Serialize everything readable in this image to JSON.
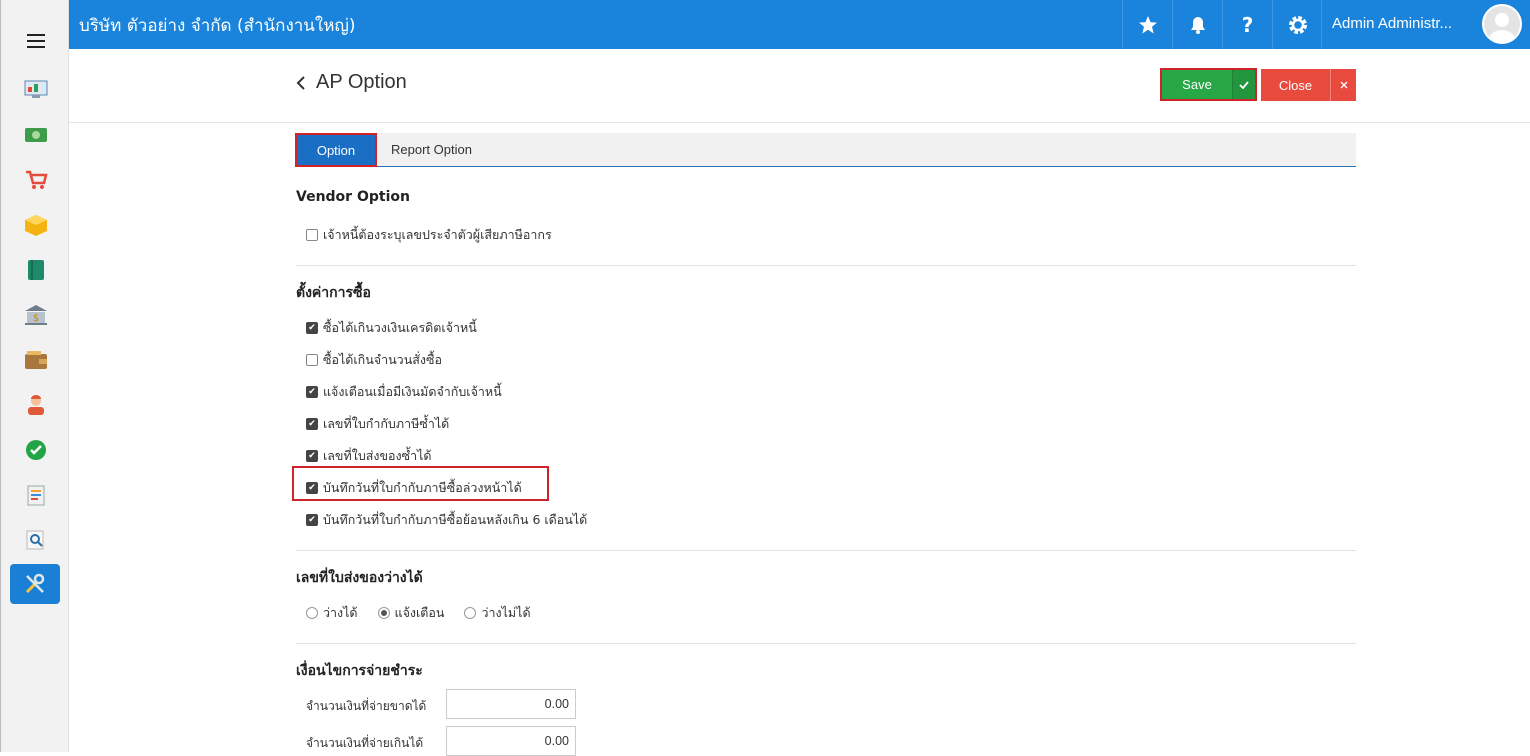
{
  "header": {
    "company": "บริษัท ตัวอย่าง จำกัด (สำนักงานใหญ่)",
    "user_name": "Admin Administr...",
    "help_label": "?"
  },
  "page": {
    "back_icon": "chevron-left-icon",
    "title": "AP Option",
    "save_label": "Save",
    "close_label": "Close"
  },
  "tabs": [
    {
      "label": "Option",
      "active": true
    },
    {
      "label": "Report Option",
      "active": false
    }
  ],
  "vendor_option": {
    "title": "Vendor Option",
    "items": [
      {
        "label": "เจ้าหนี้ต้องระบุเลขประจำตัวผู้เสียภาษีอากร",
        "checked": false
      }
    ]
  },
  "purchase_settings": {
    "title": "ตั้งค่าการซื้อ",
    "items": [
      {
        "label": "ซื้อได้เกินวงเงินเครดิตเจ้าหนี้",
        "checked": true
      },
      {
        "label": "ซื้อได้เกินจำนวนสั่งซื้อ",
        "checked": false
      },
      {
        "label": "แจ้งเตือนเมื่อมีเงินมัดจำกับเจ้าหนี้",
        "checked": true
      },
      {
        "label": "เลขที่ใบกำกับภาษีซ้ำได้",
        "checked": true
      },
      {
        "label": "เลขที่ใบส่งของซ้ำได้",
        "checked": true
      },
      {
        "label": "บันทึกวันที่ใบกำกับภาษีซื้อล่วงหน้าได้",
        "checked": true
      },
      {
        "label": "บันทึกวันที่ใบกำกับภาษีซื้อย้อนหลังเกิน 6 เดือนได้",
        "checked": true
      }
    ]
  },
  "delivery_blank": {
    "title": "เลขที่ใบส่งของว่างได้",
    "options": [
      {
        "label": "ว่างได้",
        "selected": false
      },
      {
        "label": "แจ้งเตือน",
        "selected": true
      },
      {
        "label": "ว่างไม่ได้",
        "selected": false
      }
    ]
  },
  "payment_terms": {
    "title": "เงื่อนไขการจ่ายชำระ",
    "fields": [
      {
        "label": "จำนวนเงินที่จ่ายขาดได้",
        "value": "0.00"
      },
      {
        "label": "จำนวนเงินที่จ่ายเกินได้",
        "value": "0.00"
      }
    ]
  },
  "colors": {
    "topbar": "#1a84dc",
    "save": "#27a745",
    "close": "#e84a3e",
    "tab_active": "#1a6fc4",
    "highlight": "#d0222a"
  }
}
